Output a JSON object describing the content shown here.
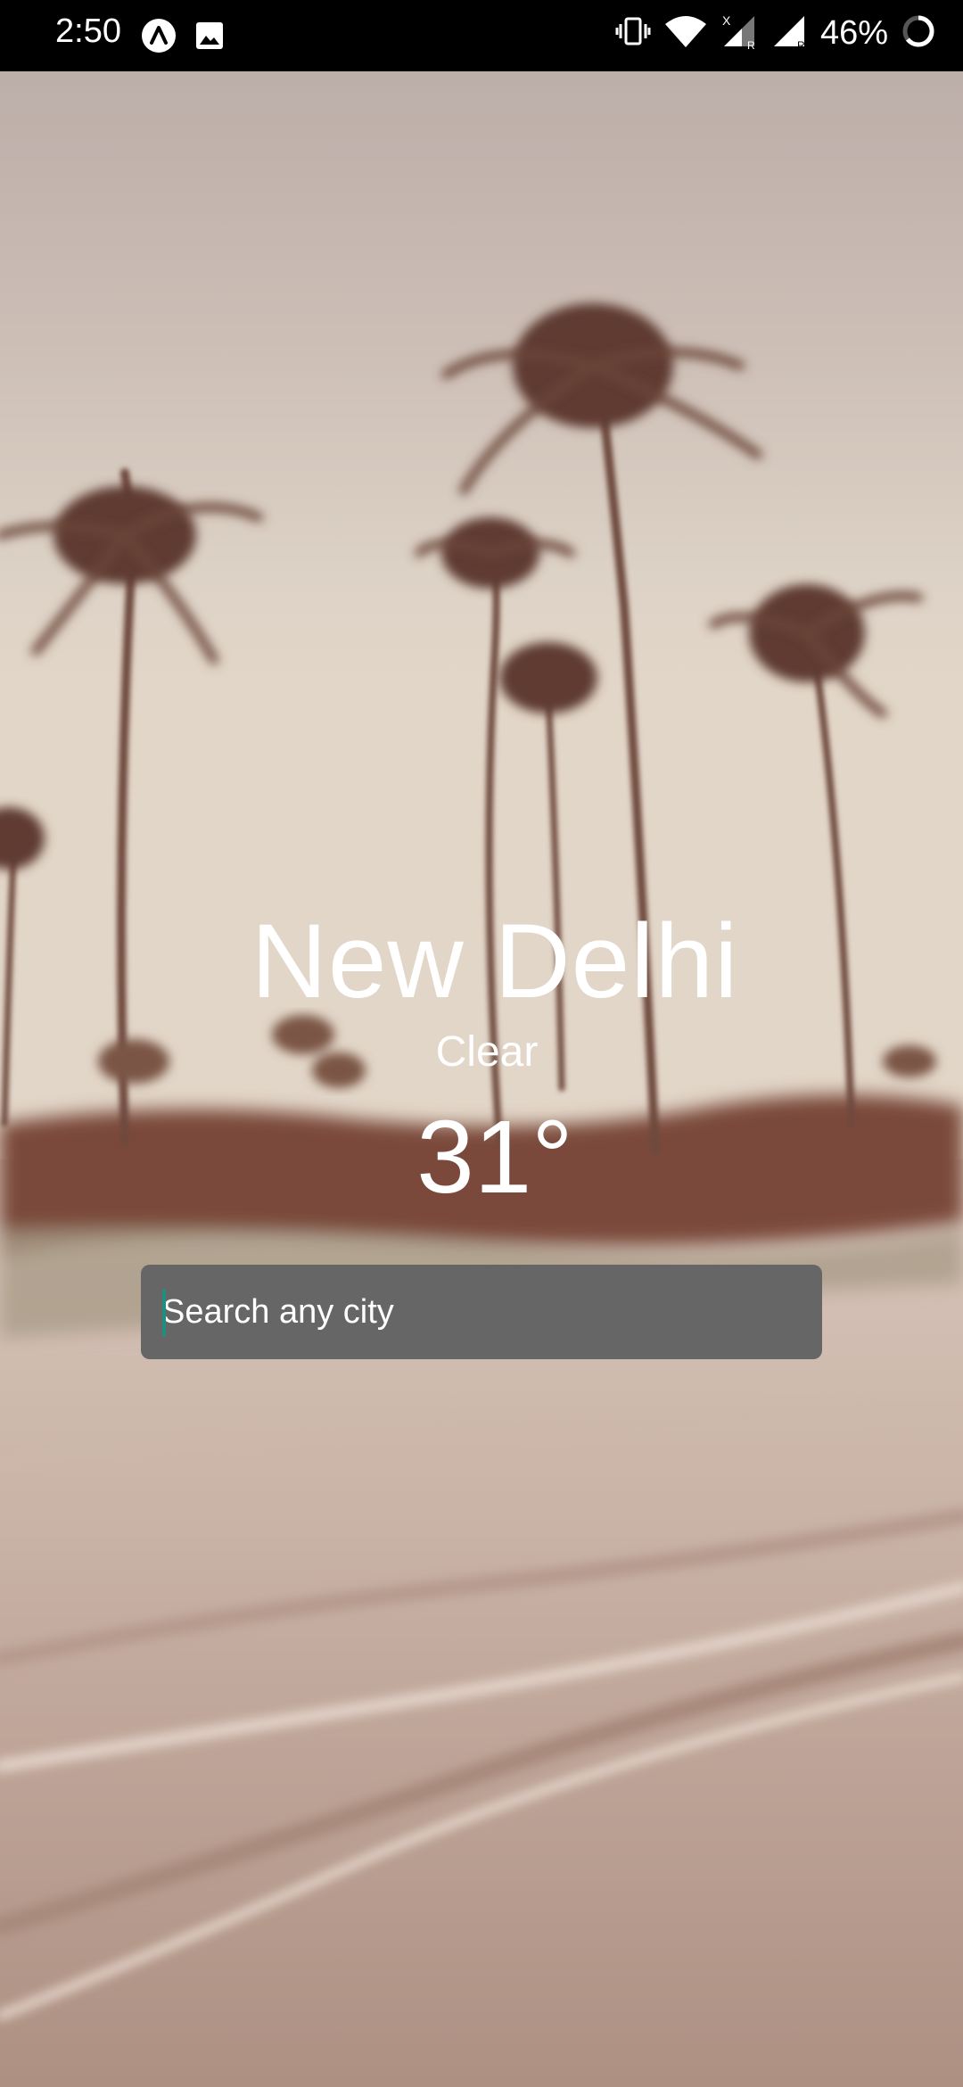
{
  "status_bar": {
    "time": "2:50",
    "battery_percent": "46%",
    "left_icons": [
      "app-notification-icon",
      "image-notification-icon"
    ],
    "right_icons": [
      "vibrate-icon",
      "wifi-icon",
      "cell-signal-1-icon",
      "cell-signal-2-icon",
      "battery-ring-icon"
    ]
  },
  "weather": {
    "city": "New Delhi",
    "condition": "Clear",
    "temperature": "31°"
  },
  "search": {
    "placeholder": "Search any city",
    "value": ""
  },
  "colors": {
    "search_background": "#666666",
    "text": "#ffffff",
    "caret": "#1e8f7e"
  }
}
